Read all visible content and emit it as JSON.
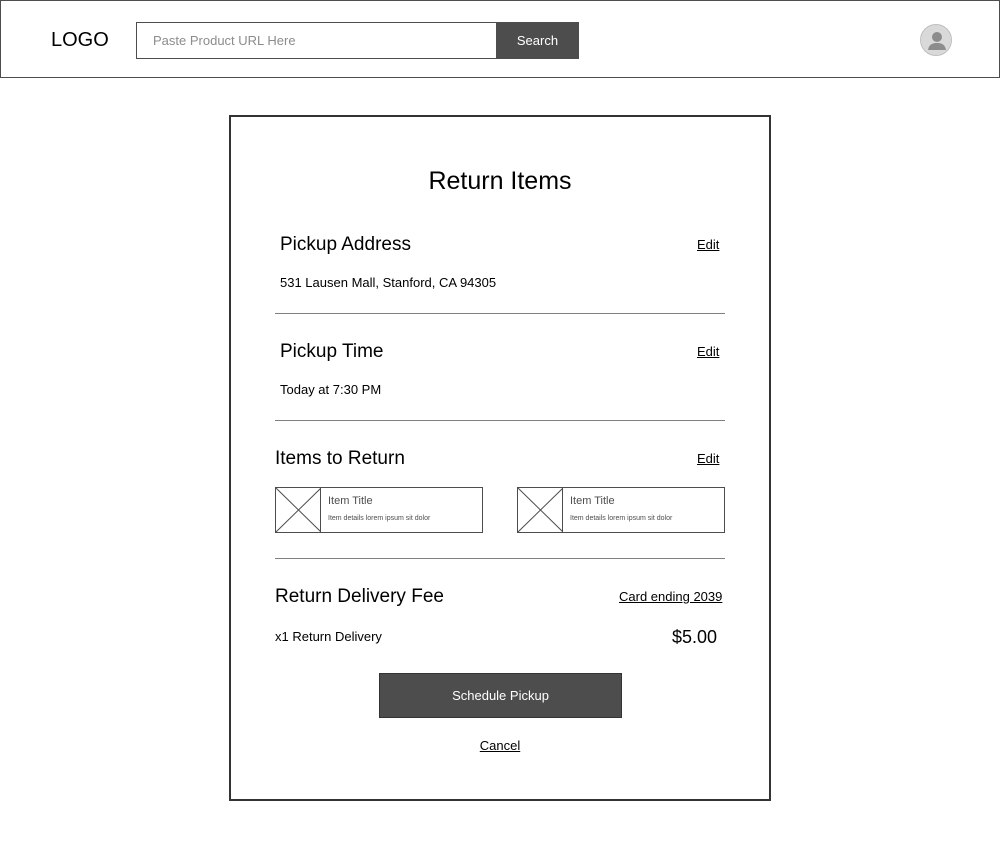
{
  "header": {
    "logo": "LOGO",
    "search": {
      "placeholder": "Paste Product URL Here",
      "value": "",
      "button_label": "Search"
    },
    "avatar_icon": "user-avatar-icon"
  },
  "return_form": {
    "title": "Return Items",
    "pickup_address": {
      "heading": "Pickup Address",
      "edit_label": "Edit",
      "value": "531 Lausen Mall, Stanford, CA 94305"
    },
    "pickup_time": {
      "heading": "Pickup Time",
      "edit_label": "Edit",
      "value": "Today at 7:30 PM"
    },
    "items_to_return": {
      "heading": "Items to Return",
      "edit_label": "Edit",
      "items": [
        {
          "title": "Item Title",
          "details": "Item details lorem ipsum sit dolor",
          "image_icon": "image-placeholder-icon"
        },
        {
          "title": "Item Title",
          "details": "Item details lorem ipsum sit dolor",
          "image_icon": "image-placeholder-icon"
        }
      ]
    },
    "delivery_fee": {
      "heading": "Return Delivery Fee",
      "payment_link": "Card ending 2039",
      "line_label": "x1 Return Delivery",
      "price": "$5.00"
    },
    "schedule_button": "Schedule Pickup",
    "cancel_link": "Cancel"
  },
  "colors": {
    "primary_button": "#4d4d4d",
    "border": "#4d4d4d",
    "divider": "#808080"
  }
}
